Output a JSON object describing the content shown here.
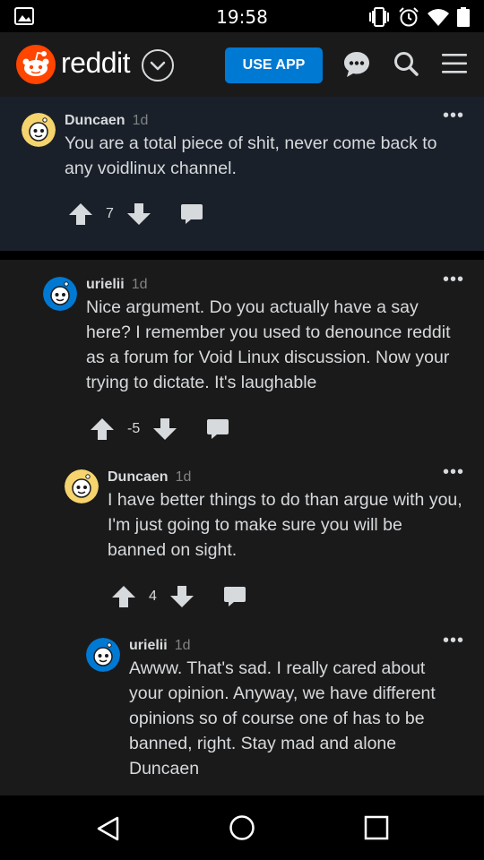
{
  "status_bar": {
    "time": "19:58",
    "icons": [
      "gallery-icon",
      "vibrate-icon",
      "alarm-icon",
      "wifi-icon",
      "battery-icon"
    ]
  },
  "header": {
    "wordmark": "reddit",
    "use_app_label": "USE APP",
    "icons": [
      "reddit-logo-icon",
      "chevron-down-icon",
      "chat-icon",
      "search-icon",
      "menu-icon"
    ],
    "colors": {
      "accent": "#0079d3",
      "brand": "#ff4500"
    }
  },
  "comments": [
    {
      "author": "Duncaen",
      "age": "1d",
      "body": "You are a total piece of shit, never come back to any voidlinux channel.",
      "score": "7",
      "avatar_color": "#f5d46e"
    },
    {
      "author": "urielii",
      "age": "1d",
      "body": "Nice argument. Do you actually have a say here? I remember you used to denounce reddit as a forum for Void Linux discussion. Now your trying to dictate. It's laughable",
      "score": "-5",
      "avatar_color": "#0079d3"
    },
    {
      "author": "Duncaen",
      "age": "1d",
      "body": "I have better things to do than argue with you, I'm just going to make sure you will be banned on sight.",
      "score": "4",
      "avatar_color": "#f5d46e"
    },
    {
      "author": "urielii",
      "age": "1d",
      "body": "Awww. That's sad. I really cared about your opinion. Anyway, we have different opinions so of course one of has to be banned, right. Stay mad and alone Duncaen",
      "avatar_color": "#0079d3"
    }
  ],
  "nav_bar": {
    "icons": [
      "back-icon",
      "home-icon",
      "recents-icon"
    ]
  }
}
